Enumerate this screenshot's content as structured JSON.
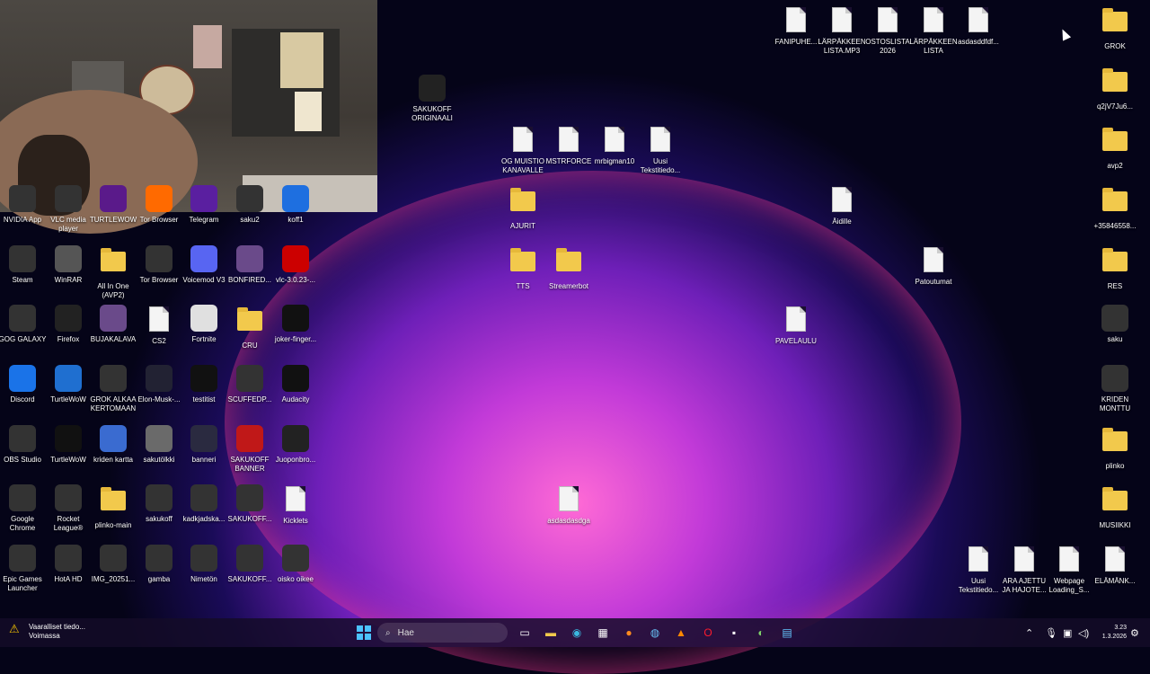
{
  "colors": {
    "accent": "#0078d4",
    "folder": "#f2c94c",
    "taskbar": "#140c28"
  },
  "icons": [
    {
      "label": "FANIPUHE...",
      "kind": "file"
    },
    {
      "label": "LÄRPÄKKEEN LISTA.MP3",
      "kind": "file"
    },
    {
      "label": "OSTOSLISTA 2026",
      "kind": "file"
    },
    {
      "label": "LÄRPÄKKEEN LISTA",
      "kind": "file"
    },
    {
      "label": "asdasddfdf...",
      "kind": "file"
    },
    {
      "label": "GROK",
      "kind": "folder"
    },
    {
      "label": "SAKUKOFF ORIGINAALI",
      "kind": "image"
    },
    {
      "label": "q2jV7Ju6...",
      "kind": "folder"
    },
    {
      "label": "OG MUISTIO KANAVALLE",
      "kind": "file"
    },
    {
      "label": "MSTRFORCE",
      "kind": "file"
    },
    {
      "label": "mrbigman10",
      "kind": "file"
    },
    {
      "label": "Uusi Tekstitiedo...",
      "kind": "file"
    },
    {
      "label": "avp2",
      "kind": "folder"
    },
    {
      "label": "AJURIT",
      "kind": "folder"
    },
    {
      "label": "Äidille",
      "kind": "file"
    },
    {
      "label": "+35846558...",
      "kind": "folder"
    },
    {
      "label": "NVIDIA App",
      "kind": "app"
    },
    {
      "label": "VLC media player",
      "kind": "app"
    },
    {
      "label": "TURTLEWOW",
      "kind": "app"
    },
    {
      "label": "Tor Browser",
      "kind": "app"
    },
    {
      "label": "Telegram",
      "kind": "app"
    },
    {
      "label": "saku2",
      "kind": "app"
    },
    {
      "label": "koff1",
      "kind": "app"
    },
    {
      "label": "Steam",
      "kind": "app"
    },
    {
      "label": "WinRAR",
      "kind": "app"
    },
    {
      "label": "All In One (AVP2)",
      "kind": "folder"
    },
    {
      "label": "Tor Browser",
      "kind": "app"
    },
    {
      "label": "Voicemod V3",
      "kind": "app"
    },
    {
      "label": "BONFIRED...",
      "kind": "app"
    },
    {
      "label": "vlc-3.0.23-...",
      "kind": "app"
    },
    {
      "label": "TTS",
      "kind": "folder"
    },
    {
      "label": "Streamerbot",
      "kind": "folder"
    },
    {
      "label": "Patoutumat",
      "kind": "file"
    },
    {
      "label": "RES",
      "kind": "folder"
    },
    {
      "label": "GOG GALAXY",
      "kind": "app"
    },
    {
      "label": "Firefox",
      "kind": "app"
    },
    {
      "label": "BUJAKALAVA",
      "kind": "app"
    },
    {
      "label": "CS2",
      "kind": "file"
    },
    {
      "label": "Fortnite",
      "kind": "app"
    },
    {
      "label": "CRU",
      "kind": "folder"
    },
    {
      "label": "joker-finger...",
      "kind": "image"
    },
    {
      "label": "PAVELAULU",
      "kind": "file"
    },
    {
      "label": "saku",
      "kind": "image"
    },
    {
      "label": "Discord",
      "kind": "app"
    },
    {
      "label": "TurtleWoW",
      "kind": "app"
    },
    {
      "label": "GROK ALKAA KERTOMAAN",
      "kind": "image"
    },
    {
      "label": "Elon-Musk-...",
      "kind": "image"
    },
    {
      "label": "testitist",
      "kind": "image"
    },
    {
      "label": "SCUFFEDP...",
      "kind": "app"
    },
    {
      "label": "Audacity",
      "kind": "app"
    },
    {
      "label": "KRIDEN MONTTU",
      "kind": "image"
    },
    {
      "label": "OBS Studio",
      "kind": "app"
    },
    {
      "label": "TurtleWoW",
      "kind": "app"
    },
    {
      "label": "kriden kartta",
      "kind": "app"
    },
    {
      "label": "sakutölkki",
      "kind": "image"
    },
    {
      "label": "banneri",
      "kind": "image"
    },
    {
      "label": "SAKUKOFF BANNER",
      "kind": "image"
    },
    {
      "label": "Juoponbro...",
      "kind": "app"
    },
    {
      "label": "plinko",
      "kind": "folder"
    },
    {
      "label": "Google Chrome",
      "kind": "app"
    },
    {
      "label": "Rocket League®",
      "kind": "app"
    },
    {
      "label": "plinko-main",
      "kind": "folder"
    },
    {
      "label": "sakukoff",
      "kind": "image"
    },
    {
      "label": "kadkjadska...",
      "kind": "image"
    },
    {
      "label": "SAKUKOFF...",
      "kind": "image"
    },
    {
      "label": "Kicklets",
      "kind": "file"
    },
    {
      "label": "asdasdasdga",
      "kind": "file"
    },
    {
      "label": "MUSIIKKI",
      "kind": "folder"
    },
    {
      "label": "Epic Games Launcher",
      "kind": "app"
    },
    {
      "label": "HotA HD",
      "kind": "app"
    },
    {
      "label": "IMG_20251...",
      "kind": "image"
    },
    {
      "label": "gamba",
      "kind": "image"
    },
    {
      "label": "Nimetön",
      "kind": "image"
    },
    {
      "label": "SAKUKOFF...",
      "kind": "image"
    },
    {
      "label": "oisko oikee",
      "kind": "image"
    },
    {
      "label": "Uusi Tekstitiedo...",
      "kind": "file"
    },
    {
      "label": "ARA AJETTU JA HAJOTE...",
      "kind": "file"
    },
    {
      "label": "Webpage Loading_S...",
      "kind": "file"
    },
    {
      "label": "ELÄMÄNK...",
      "kind": "file"
    }
  ],
  "taskbar": {
    "notice_title": "Vaaralliset tiedo...",
    "notice_sub": "Voimassa",
    "search_placeholder": "Hae",
    "time": "3.23",
    "date": "1.3.2026"
  }
}
